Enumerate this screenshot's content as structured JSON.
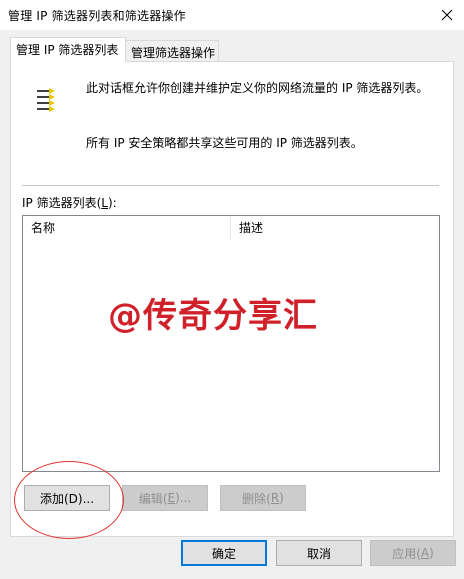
{
  "window": {
    "title": "管理 IP 筛选器列表和筛选器操作",
    "close_glyph": "✕"
  },
  "tabs": [
    {
      "label": "管理 IP 筛选器列表",
      "active": true
    },
    {
      "label": "管理筛选器操作",
      "active": false
    }
  ],
  "description": {
    "icon": "ip-filter-list-icon",
    "text": "此对话框允许你创建并维护定义你的网络流量的 IP 筛选器列表。",
    "shared_text": "所有 IP 安全策略都共享这些可用的 IP 筛选器列表。"
  },
  "filter_list": {
    "label_prefix": "IP 筛选器列表(",
    "label_key": "L",
    "label_suffix": "):",
    "columns": [
      "名称",
      "描述"
    ],
    "rows": []
  },
  "list_buttons": {
    "add": "添加(D)...",
    "edit_prefix": "编辑(",
    "edit_key": "E",
    "edit_suffix": ")...",
    "delete_prefix": "删除(",
    "delete_key": "R",
    "delete_suffix": ")"
  },
  "dialog_buttons": {
    "ok": "确定",
    "cancel": "取消",
    "apply_prefix": "应用(",
    "apply_key": "A",
    "apply_suffix": ")"
  },
  "watermark": "@传奇分享汇",
  "colors": {
    "accent": "#0078d7",
    "watermark": "#d0202a",
    "annotation": "#e0342e",
    "dialog_bg": "#f0f0f0"
  }
}
